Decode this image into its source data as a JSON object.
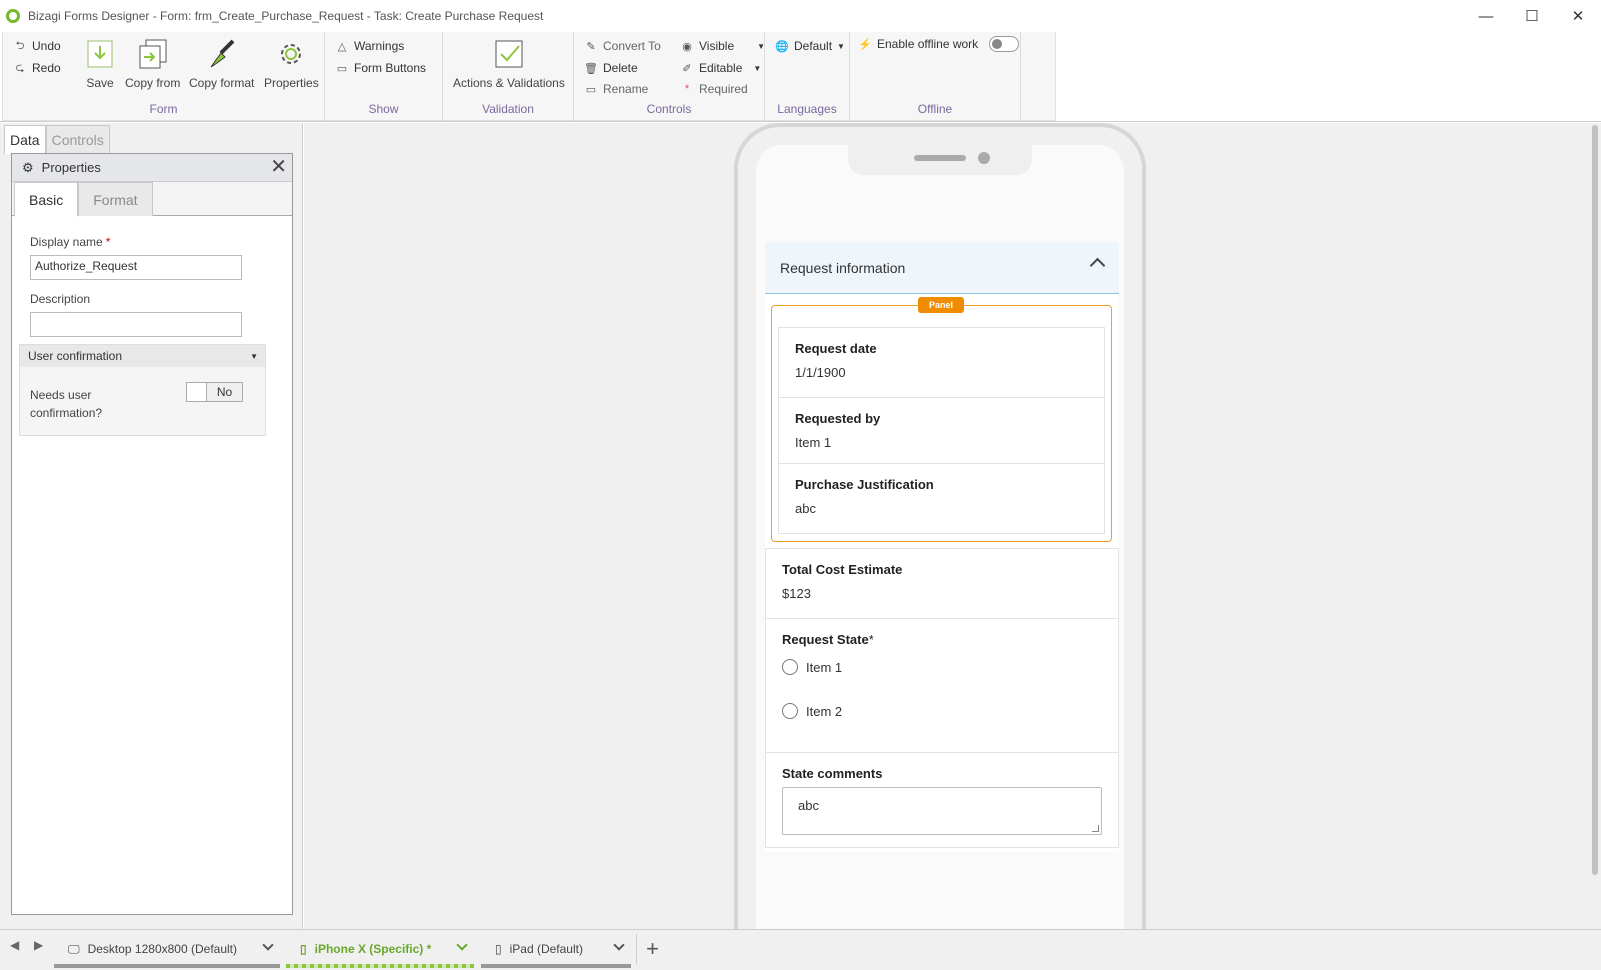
{
  "window": {
    "title": "Bizagi Forms Designer  - Form: frm_Create_Purchase_Request - Task:  Create Purchase Request",
    "controls": [
      "—",
      "☐",
      "✕"
    ]
  },
  "ribbon": {
    "form_group": {
      "label": "Form",
      "undo": "Undo",
      "redo": "Redo",
      "save": "Save",
      "copy_from": "Copy from",
      "copy_format": "Copy format",
      "properties": "Properties"
    },
    "show_group": {
      "label": "Show",
      "warnings": "Warnings",
      "form_buttons": "Form Buttons"
    },
    "validation_group": {
      "label": "Validation",
      "actions_validations": "Actions & Validations"
    },
    "controls_group": {
      "label": "Controls",
      "convert_to": "Convert To",
      "delete": "Delete",
      "rename": "Rename",
      "visible": "Visible",
      "editable": "Editable",
      "required": "Required"
    },
    "languages_group": {
      "label": "Languages",
      "default": "Default"
    },
    "offline_group": {
      "label": "Offline",
      "enable_offline": "Enable offline work",
      "enabled": false
    }
  },
  "left_panel": {
    "tabs": [
      "Data",
      "Controls"
    ],
    "properties": {
      "title": "Properties",
      "tabs": [
        "Basic",
        "Format"
      ],
      "display_name_label": "Display name",
      "display_name_required": "*",
      "display_name_value": "Authorize_Request",
      "description_label": "Description",
      "description_value": "",
      "section_title": "User confirmation",
      "needs_confirmation_label_1": "Needs user",
      "needs_confirmation_label_2": "confirmation?",
      "needs_confirmation_value": "No"
    }
  },
  "form": {
    "accordion_title": "Request information",
    "panel_badge": "Panel",
    "fields": [
      {
        "label": "Request date",
        "value": "1/1/1900"
      },
      {
        "label": "Requested by",
        "value": "Item 1"
      },
      {
        "label": "Purchase Justification",
        "value": "abc"
      }
    ],
    "total_cost": {
      "label": "Total Cost Estimate",
      "value": "$123"
    },
    "request_state": {
      "label": "Request State",
      "required": "*",
      "options": [
        "Item 1",
        "Item 2"
      ]
    },
    "state_comments": {
      "label": "State comments",
      "value": "abc"
    }
  },
  "bottom_tabs": {
    "devices": [
      {
        "label": "Desktop 1280x800 (Default)",
        "active": false
      },
      {
        "label": "iPhone X (Specific)",
        "modified": "*",
        "active": true
      },
      {
        "label": "iPad (Default)",
        "active": false
      }
    ],
    "add": "+"
  },
  "colors": {
    "accent_green": "#8cc63f",
    "panel_orange": "#f08c00",
    "ribbon_group_label": "#7b6aa0"
  }
}
